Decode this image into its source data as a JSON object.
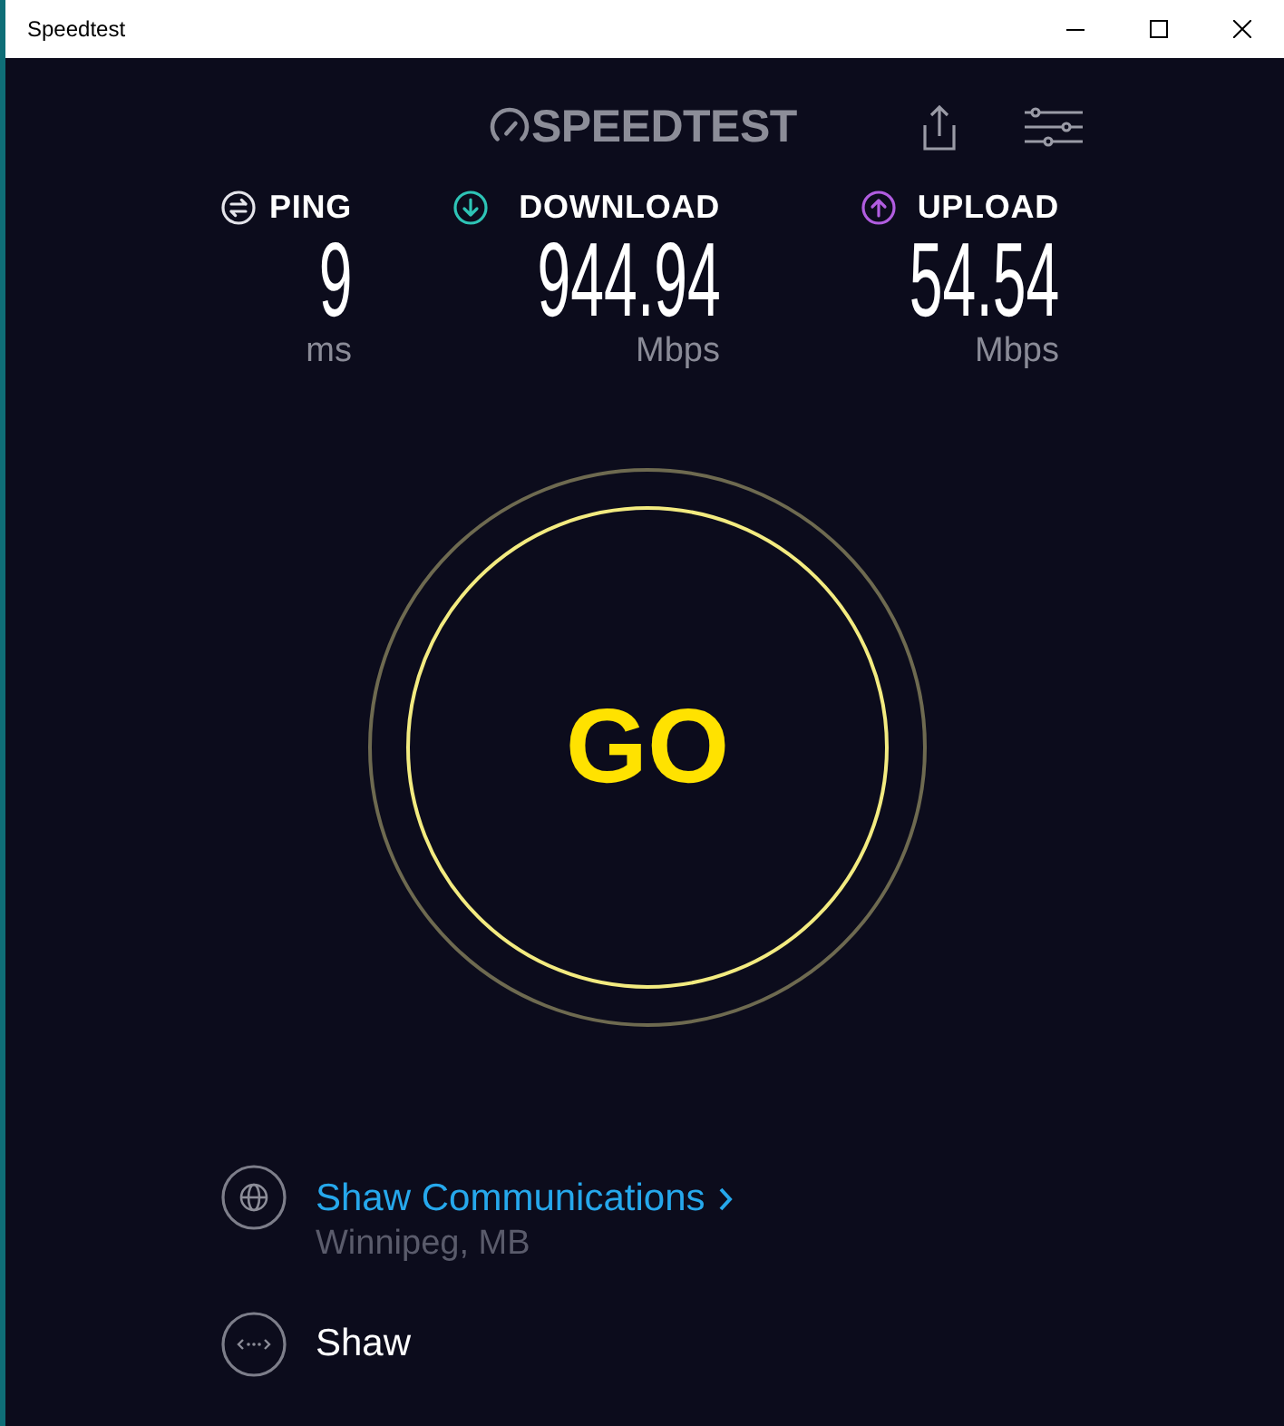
{
  "window": {
    "title": "Speedtest"
  },
  "header": {
    "logo": "SPEEDTEST"
  },
  "metrics": [
    {
      "kind": "ping",
      "label": "PING",
      "value": "9",
      "unit": "ms",
      "color": "#e4e4ea"
    },
    {
      "kind": "download",
      "label": "DOWNLOAD",
      "value": "944.94",
      "unit": "Mbps",
      "color": "#2ec4b6"
    },
    {
      "kind": "upload",
      "label": "UPLOAD",
      "value": "54.54",
      "unit": "Mbps",
      "color": "#b15de0"
    }
  ],
  "go_button": {
    "label": "GO"
  },
  "server": {
    "name": "Shaw Communications",
    "location": "Winnipeg, MB"
  },
  "provider": {
    "name": "Shaw"
  }
}
